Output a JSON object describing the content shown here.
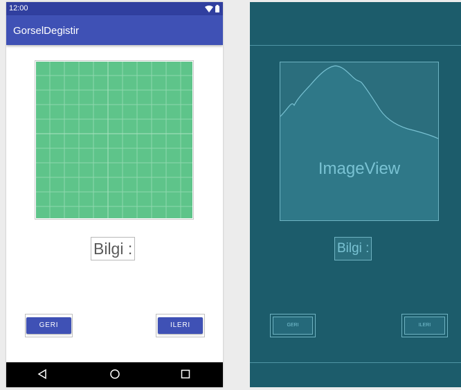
{
  "status_bar": {
    "time": "12:00",
    "icons": [
      "wifi-icon",
      "battery-icon"
    ],
    "color": "#303f9f"
  },
  "app_bar": {
    "title": "GorselDegistir",
    "color": "#3f51b5"
  },
  "main": {
    "image_color": "#5ec48a",
    "info_label": "Bilgi :",
    "back_button": "GERI",
    "next_button": "ILERI"
  },
  "nav_bar": {
    "icons": [
      "back-triangle-icon",
      "home-circle-icon",
      "recents-square-icon"
    ]
  },
  "blueprint": {
    "image_label": "ImageView",
    "info_label": "Bilgi :",
    "back_button": "GERI",
    "next_button": "ILERI",
    "background": "#1c5c6b"
  }
}
